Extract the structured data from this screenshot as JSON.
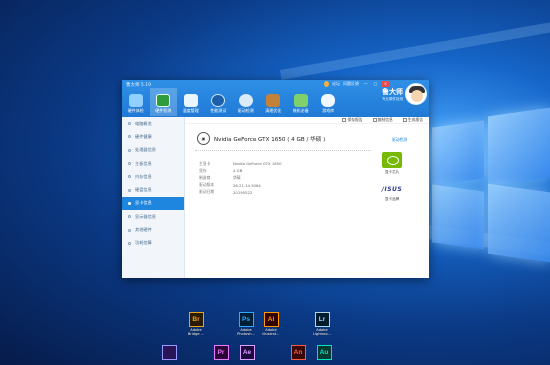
{
  "app": {
    "title": "鲁大师 5.19",
    "controls": {
      "gift": "",
      "login": "论坛",
      "feedback": "问题反馈",
      "min": "—",
      "max": "□",
      "close": "×"
    },
    "brand_name": "鲁大师",
    "brand_slogan": "专业硬件检测"
  },
  "nav": [
    {
      "label": "硬件体检"
    },
    {
      "label": "硬件检测"
    },
    {
      "label": "温度管理"
    },
    {
      "label": "性能测试"
    },
    {
      "label": "驱动检测"
    },
    {
      "label": "清理优化"
    },
    {
      "label": "装机必备"
    },
    {
      "label": "游戏库"
    }
  ],
  "sidebar": [
    {
      "label": "电脑概览"
    },
    {
      "label": "硬件健康"
    },
    {
      "label": "处理器信息"
    },
    {
      "label": "主板信息"
    },
    {
      "label": "内存信息"
    },
    {
      "label": "硬盘信息"
    },
    {
      "label": "显卡信息"
    },
    {
      "label": "显示器信息"
    },
    {
      "label": "其他硬件"
    },
    {
      "label": "功耗估算"
    }
  ],
  "toolbar": {
    "save": "保存报告",
    "copy": "复制信息",
    "generate": "生成报告"
  },
  "gpu": {
    "title": "Nvidia GeForce GTX 1650 ( 4 GB / 华硕 )",
    "driver_link": "驱动检测",
    "rows": [
      {
        "k": "主显卡",
        "v": "Nvidia GeForce GTX 1650"
      },
      {
        "k": "显存",
        "v": "4 GB"
      },
      {
        "k": "制造商",
        "v": "华硕"
      },
      {
        "k": "驱动版本",
        "v": "26.21.14.3064"
      },
      {
        "k": "驱动日期",
        "v": "20190522"
      }
    ],
    "vendors": [
      {
        "label": "显卡芯片"
      },
      {
        "label": "显卡品牌"
      }
    ]
  },
  "desktop_icons": [
    {
      "abbr": "Br",
      "label": "Adobe\nBridge ...",
      "color": "#e8a317",
      "bg": "#2b1a04"
    },
    {
      "abbr": "Ps",
      "label": "Adobe\nPhotosh...",
      "color": "#31a8ff",
      "bg": "#001e36"
    },
    {
      "abbr": "Ai",
      "label": "Adobe\nIllustrat...",
      "color": "#ff9a00",
      "bg": "#330000"
    },
    {
      "abbr": "Lr",
      "label": "Adobe\nLightroo...",
      "color": "#add5ec",
      "bg": "#001a2e"
    },
    {
      "abbr": "",
      "label": "",
      "color": "#9999ff",
      "bg": "#2a1458"
    },
    {
      "abbr": "Pr",
      "label": "",
      "color": "#ea77ff",
      "bg": "#2a0634"
    },
    {
      "abbr": "Ae",
      "label": "",
      "color": "#d8a1ff",
      "bg": "#1f0740"
    },
    {
      "abbr": "An",
      "label": "",
      "color": "#ff5c3a",
      "bg": "#3a0808"
    },
    {
      "abbr": "Au",
      "label": "",
      "color": "#00e4bb",
      "bg": "#003a33"
    }
  ]
}
